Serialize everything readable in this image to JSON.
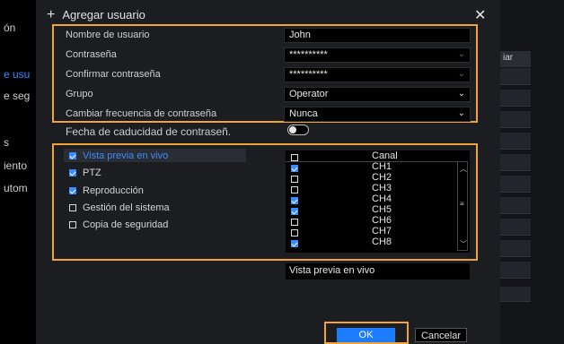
{
  "background": {
    "sidebar_texts": [
      "ón",
      "e usu",
      "e seg",
      "s",
      "iento",
      "utom"
    ],
    "right_header": "iar"
  },
  "dialog": {
    "title": "Agregar usuario",
    "fields": [
      {
        "label": "Nombre de usuario",
        "value": "John"
      },
      {
        "label": "Contraseña",
        "value": "**********"
      },
      {
        "label": "Confirmar contraseña",
        "value": "**********"
      },
      {
        "label": "Grupo",
        "value": "Operator"
      },
      {
        "label": "Cambiar frecuencia de contraseña",
        "value": "Nunca"
      }
    ],
    "expiry_label": "Fecha de caducidad de contraseñ.",
    "expiry_toggle_on": false,
    "permissions": [
      {
        "label": "Vista previa en vivo",
        "checked": true,
        "active": true
      },
      {
        "label": "PTZ",
        "checked": true,
        "active": false
      },
      {
        "label": "Reproducción",
        "checked": true,
        "active": false
      },
      {
        "label": "Gestión del sistema",
        "checked": false,
        "active": false
      },
      {
        "label": "Copia de seguridad",
        "checked": false,
        "active": false
      }
    ],
    "channel_header": "Canal",
    "channels": [
      {
        "name": "CH1",
        "checked": true
      },
      {
        "name": "CH2",
        "checked": false
      },
      {
        "name": "CH3",
        "checked": false
      },
      {
        "name": "CH4",
        "checked": true
      },
      {
        "name": "CH5",
        "checked": true
      },
      {
        "name": "CH6",
        "checked": false
      },
      {
        "name": "CH7",
        "checked": false
      },
      {
        "name": "CH8",
        "checked": true
      }
    ],
    "permission_description": "Vista previa en vivo",
    "ok_label": "OK",
    "cancel_label": "Cancelar"
  },
  "colors": {
    "accent": "#1e7cff",
    "highlight": "#f2a23a"
  }
}
